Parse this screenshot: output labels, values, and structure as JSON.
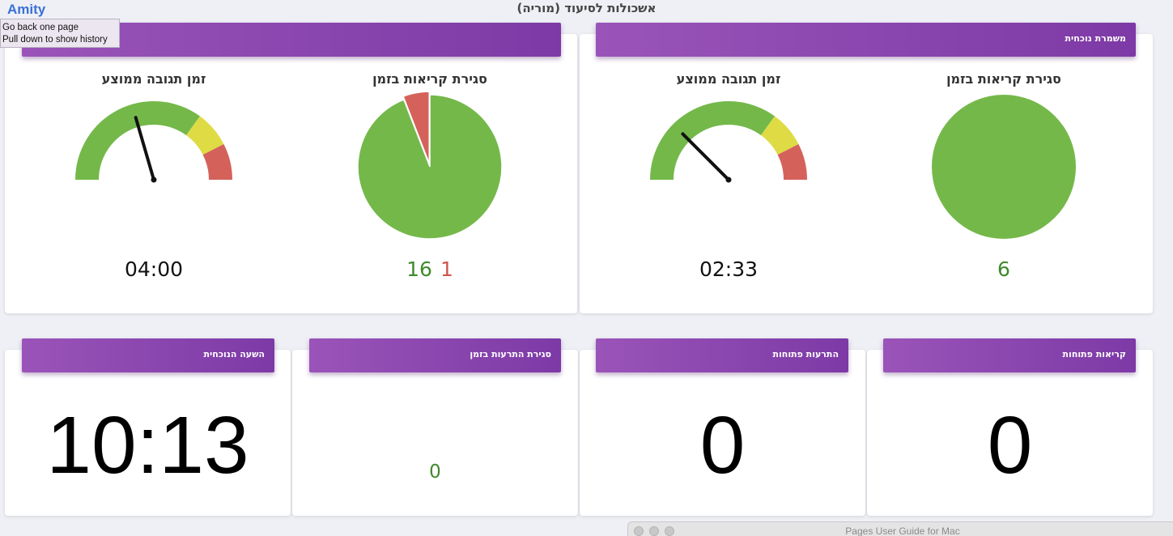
{
  "app": {
    "name": "Amity",
    "title": "אשכולות לסיעוד (מוריה)"
  },
  "tooltip": {
    "line1": "Go back one page",
    "line2": "Pull down to show history"
  },
  "colors": {
    "green": "#74b84a",
    "yellow": "#dfdb45",
    "red": "#d4625b",
    "header": "#8a45ae"
  },
  "top_left_panel": {
    "header": "",
    "gauge": {
      "title": "זמן תגובה ממוצע",
      "value": "04:00",
      "needle_fraction": 0.41
    },
    "pie": {
      "title": "סגירת קריאות בזמן",
      "on_time": "16",
      "late": "1"
    }
  },
  "top_right_panel": {
    "header": "משמרת נוכחית",
    "gauge": {
      "title": "זמן תגובה ממוצע",
      "value": "02:33",
      "needle_fraction": 0.25
    },
    "pie": {
      "title": "סגירת קריאות בזמן",
      "on_time": "6"
    }
  },
  "bottom_cards": [
    {
      "header": "השעה הנוכחית",
      "value": "10:13"
    },
    {
      "header": "סגירת התרעות בזמן",
      "value": "0"
    },
    {
      "header": "התרעות פתוחות",
      "value": "0"
    },
    {
      "header": "קריאות פתוחות",
      "value": "0"
    }
  ],
  "mac_window": {
    "title": "Pages User Guide for Mac"
  },
  "chart_data": [
    {
      "type": "gauge",
      "title": "זמן תגובה ממוצע",
      "value": "04:00",
      "bands": [
        {
          "color": "#74b84a",
          "from": 0,
          "to": 0.7
        },
        {
          "color": "#dfdb45",
          "from": 0.7,
          "to": 0.85
        },
        {
          "color": "#d4625b",
          "from": 0.85,
          "to": 1
        }
      ],
      "needle": 0.41
    },
    {
      "type": "pie",
      "title": "סגירת קריאות בזמן",
      "slices": [
        {
          "label": "on_time",
          "value": 16,
          "color": "#74b84a"
        },
        {
          "label": "late",
          "value": 1,
          "color": "#d4625b"
        }
      ]
    },
    {
      "type": "gauge",
      "title": "זמן תגובה ממוצע",
      "value": "02:33",
      "bands": [
        {
          "color": "#74b84a",
          "from": 0,
          "to": 0.7
        },
        {
          "color": "#dfdb45",
          "from": 0.7,
          "to": 0.85
        },
        {
          "color": "#d4625b",
          "from": 0.85,
          "to": 1
        }
      ],
      "needle": 0.25
    },
    {
      "type": "pie",
      "title": "סגירת קריאות בזמן",
      "slices": [
        {
          "label": "on_time",
          "value": 6,
          "color": "#74b84a"
        }
      ]
    }
  ]
}
